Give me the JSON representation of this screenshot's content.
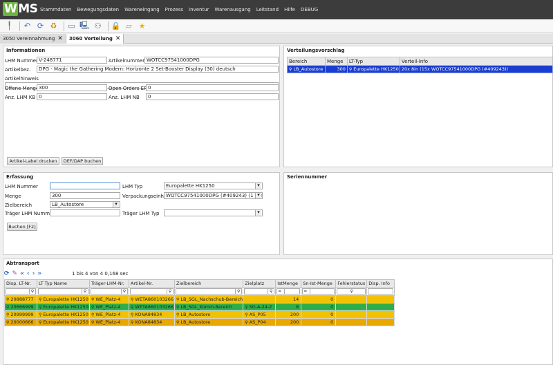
{
  "app": {
    "logo_w": "W",
    "logo_rest": "MS"
  },
  "menu": [
    "Stammdaten",
    "Bewegungsdaten",
    "Wareneingang",
    "Prozess",
    "Inventur",
    "Warenausgang",
    "Leitstand",
    "Hilfe",
    "DEBUG"
  ],
  "tabs": [
    {
      "label": "3050 Vereinnahmung",
      "close": "✕"
    },
    {
      "label": "3060 Verteilung",
      "close": "✕"
    }
  ],
  "info": {
    "title": "Informationen",
    "lhm_label": "LHM Nummer",
    "lhm_value": "V-248771",
    "artnr_label": "Artikelnummer",
    "artnr_value": "WOTCC97541000DPG",
    "bez_label": "Artikelbez.",
    "bez_value": "DPG - Magic the Gathering Modern: Horizonte 2 Set-Booster Display (30) deutsch",
    "hinweis_label": "Artikelhinweis",
    "hinweis_value": "",
    "offen_label": "Offene Menge",
    "offen_value": "300",
    "erp_label": "Open Orders ERP",
    "erp_value": "0",
    "kb_label": "Anz. LHM KB",
    "kb_value": "0",
    "nb_label": "Anz. LHM NB",
    "nb_value": "0",
    "btn_label": "Artikel-Label drucken",
    "btn_def": "DEF/DAP buchen"
  },
  "verteilung": {
    "title": "Verteilungsvorschlag",
    "headers": [
      "Bereich",
      "Menge",
      "LT-Typ",
      "Verteil-Info"
    ],
    "rows": [
      {
        "bereich": "LB_Autostore",
        "menge": "300",
        "lt": "Europalette HK1250",
        "info": "20x 8in (15x WOTCC97541000DPG (#409243))"
      }
    ]
  },
  "erfassung": {
    "title": "Erfassung",
    "lhm_label": "LHM Nummer",
    "lhm_value": "",
    "lhmtyp_label": "LHM Typ",
    "lhmtyp_value": "Europalette HK1250",
    "menge_label": "Menge",
    "menge_value": "300",
    "vpe_label": "Verpackungseinheit",
    "vpe_value": "WOTCC97541000DPG (#409243) (1 Stk)",
    "ziel_label": "Zielbereich",
    "ziel_value": "LB_Autostore",
    "traeger_label": "Träger LHM Nummer",
    "traeger_value": "",
    "traegertyp_label": "Träger LHM Typ",
    "traegertyp_value": "",
    "buchen_label": "Buchen [F2]"
  },
  "serien": {
    "title": "Seriennummer"
  },
  "abtransport": {
    "title": "Abtransport",
    "paging": "1 bis 4 von 4  0,168 sec",
    "headers": [
      "Disp. LT-Nr.",
      "LT Typ Name",
      "Träger-LHM-Nr.",
      "Artikel-Nr.",
      "Zielbereich",
      "Zielplatz",
      "IstMenge",
      "Sn-Ist-Menge",
      "Fehlerstatus",
      "Disp. Info"
    ],
    "filter_eq": "=",
    "rows": [
      {
        "lt": "20888777",
        "typ": "Europalette HK1250",
        "traeger": "WE_Platz-4",
        "art": "WETA860103266",
        "ziel": "LB_SGL_Nachschub-Bereich",
        "platz": "",
        "ist": "14",
        "sn": "0",
        "color": "#f2c200"
      },
      {
        "lt": "20666999",
        "typ": "Europalette HK1250",
        "traeger": "WE_Platz-4",
        "art": "WETA860103266",
        "ziel": "LB_SGL_Komm-Bereich",
        "platz": "SG-A-24-2",
        "ist": "8",
        "sn": "0",
        "color": "#2eae4a"
      },
      {
        "lt": "20999999",
        "typ": "Europalette HK1250",
        "traeger": "WE_Platz-4",
        "art": "KONA84834",
        "ziel": "LB_Autostore",
        "platz": "AS_P05",
        "ist": "200",
        "sn": "0",
        "color": "#f2c200"
      },
      {
        "lt": "20000666",
        "typ": "Europalette HK1250",
        "traeger": "WE_Platz-4",
        "art": "KONA84834",
        "ziel": "LB_Autostore",
        "platz": "AS_P04",
        "ist": "200",
        "sn": "0",
        "color": "#e8a800"
      }
    ]
  }
}
